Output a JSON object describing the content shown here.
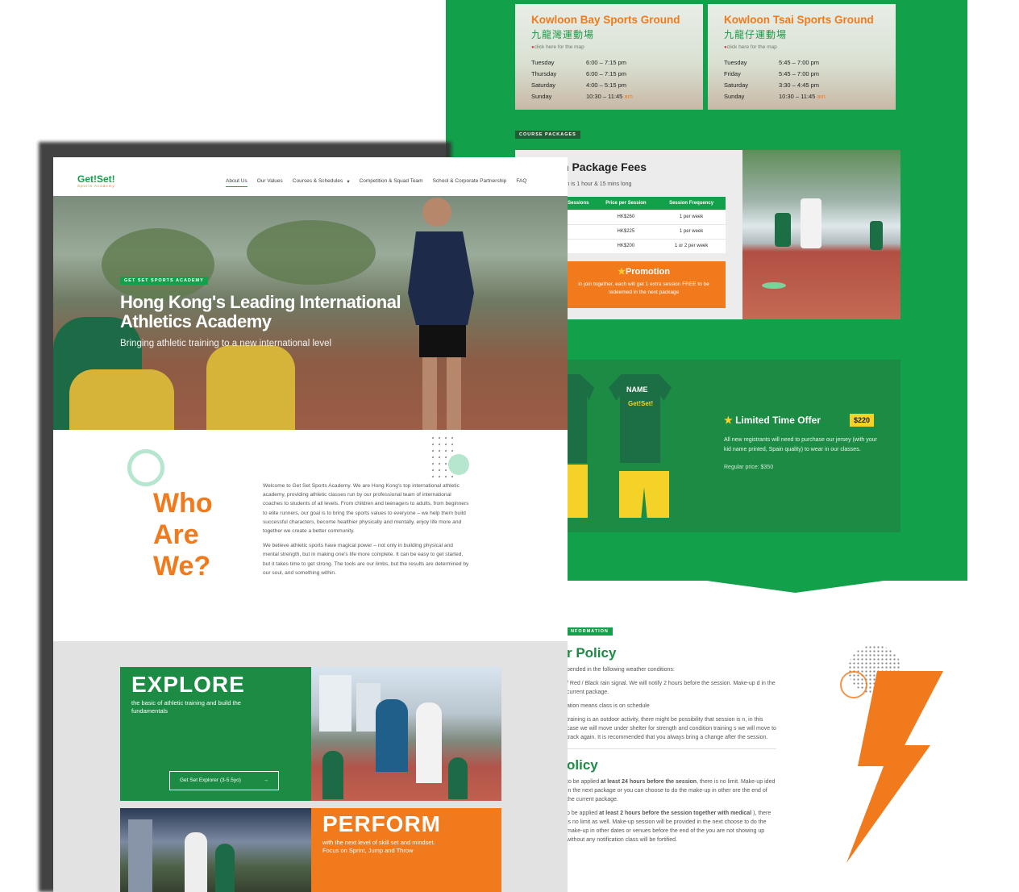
{
  "back": {
    "venues": [
      {
        "name": "Kowloon Bay Sports Ground",
        "chinese": "九龍灣運動場",
        "map_link": "click here for the map",
        "schedule": [
          {
            "day": "Tuesday",
            "time": "6:00 – 7:15 pm",
            "am": ""
          },
          {
            "day": "Thursday",
            "time": "6:00 – 7:15 pm",
            "am": ""
          },
          {
            "day": "Saturday",
            "time": "4:00 – 5:15 pm",
            "am": ""
          },
          {
            "day": "Sunday",
            "time": "10:30 – 11:45 ",
            "am": "am"
          }
        ]
      },
      {
        "name": "Kowloon Tsai Sports Ground",
        "chinese": "九龍仔運動場",
        "map_link": "click here for the map",
        "schedule": [
          {
            "day": "Tuesday",
            "time": "5:45 – 7:00 pm",
            "am": ""
          },
          {
            "day": "Friday",
            "time": "5:45 – 7:00 pm",
            "am": ""
          },
          {
            "day": "Saturday",
            "time": "3:30 – 4:45 pm",
            "am": ""
          },
          {
            "day": "Sunday",
            "time": "10:30 – 11:45 ",
            "am": "am"
          }
        ]
      }
    ],
    "course_tag": "COURSE PACKAGES",
    "fees": {
      "title": "n Package Fees",
      "subtitle": "ion is 1 hour & 15 mins long",
      "headers": [
        "Sessions",
        "Price per Session",
        "Session Frequency"
      ],
      "rows": [
        [
          "",
          "HK$260",
          "1 per week"
        ],
        [
          "",
          "HK$225",
          "1 per week"
        ],
        [
          "",
          "HK$200",
          "1 or 2 per week"
        ]
      ],
      "promo_title": "Promotion",
      "promo_text": "in join together, each will get 1 extra session FREE to be redeemed in the next package"
    },
    "jersey": {
      "name_print": "NAME",
      "logo_print": "Get!Set!",
      "offer_title": "Limited Time Offer",
      "offer_price": "$220",
      "offer_text": "All new registrants will need to purchase our jersey (with your kid name printed, Spain quality) to wear in our classes.",
      "regular_price": "Regular price: $350"
    },
    "info": {
      "tag": "NFORMATION",
      "h1": "r Policy",
      "p1": "pended in the following weather conditions:",
      "p2": "/ Red / Black rain signal. We will notify 2 hours before the session. Make-up d in the current package.",
      "p3": "ation means class is on schedule",
      "p4": "training is an outdoor activity, there might be possibility that session is n, in this case we will move under shelter for strength and condition training s we will move to track again. It is recommended that you always bring a change after the session.",
      "h2": "olicy",
      "p5_pre": "to be applied ",
      "p5_bold": "at least 24 hours before the session",
      "p5_post": ", there is no limit. Make-up ided in the next package or you can choose to do the make-up in other ore the end of the current package.",
      "p6_pre": "o be applied ",
      "p6_bold": "at least 2 hours before the session together with medical ",
      "p6_post": "), there is no limit as well. Make-up session will be provided in the next choose to do the make-up in other dates or venues before the end of the you are not showing up without any notification class will be fortified."
    }
  },
  "front": {
    "logo": "Get!Set!",
    "logo_sub": "Sports Academy",
    "menu": [
      "About Us",
      "Our Values",
      "Courses & Schedules",
      "▾",
      "Competition & Squad Team",
      "School & Corporate Partnership",
      "FAQ"
    ],
    "hero": {
      "tag": "GET SET SPORTS ACADEMY",
      "title": "Hong Kong's Leading International Athletics Academy",
      "subtitle": "Bringing athletic training to a new international level"
    },
    "who": {
      "heading_1": "Who",
      "heading_2": "Are",
      "heading_3": "We?",
      "p1": "Welcome to Get Set Sports Academy. We are Hong Kong's top international athletic academy, providing athletic classes run by our professional team of international coaches to students of all levels. From children and teenagers to adults, from beginners to elite runners, our goal is to bring the sports values to everyone – we help them build successful characters, become healthier physically and mentally, enjoy life more and together we create a better community.",
      "p2": "We believe athletic sports have magical power – not only in building physical and mental strength, but in making one's life more complete. It can be easy to get started, but it takes time to get strong. The tools are our limbs, but the results are determined by our soul, and something within."
    },
    "explore": {
      "title": "EXPLORE",
      "desc": "the basic of athletic training and build the fundamentals",
      "button": "Get Set Explorer (3-5.5yo)",
      "arrow": "→"
    },
    "perform": {
      "title": "PERFORM",
      "desc": "with the next level of skill set and mindset. Focus on Sprint, Jump and Throw"
    }
  },
  "colors": {
    "green": "#12a14a",
    "dark_green": "#1c8b43",
    "orange": "#f07a1c",
    "yellow": "#f5d228"
  }
}
